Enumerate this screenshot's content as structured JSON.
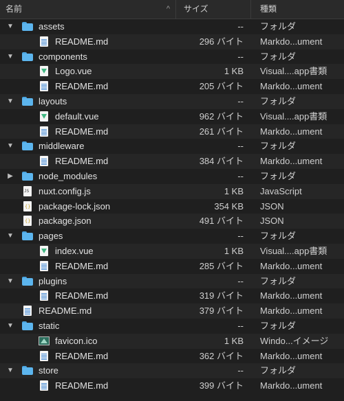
{
  "header": {
    "name_label": "名前",
    "size_label": "サイズ",
    "kind_label": "種類",
    "sort_indicator": "^"
  },
  "rows": [
    {
      "indent": 0,
      "disclosure": "open",
      "icon": "folder-icon",
      "name": "assets",
      "size": "--",
      "kind": "フォルダ"
    },
    {
      "indent": 1,
      "disclosure": "none",
      "icon": "markdown-file-icon",
      "name": "README.md",
      "size": "296 バイト",
      "kind": "Markdo...ument"
    },
    {
      "indent": 0,
      "disclosure": "open",
      "icon": "folder-icon",
      "name": "components",
      "size": "--",
      "kind": "フォルダ"
    },
    {
      "indent": 1,
      "disclosure": "none",
      "icon": "vue-file-icon",
      "name": "Logo.vue",
      "size": "1 KB",
      "kind": "Visual....app書類"
    },
    {
      "indent": 1,
      "disclosure": "none",
      "icon": "markdown-file-icon",
      "name": "README.md",
      "size": "205 バイト",
      "kind": "Markdo...ument"
    },
    {
      "indent": 0,
      "disclosure": "open",
      "icon": "folder-icon",
      "name": "layouts",
      "size": "--",
      "kind": "フォルダ"
    },
    {
      "indent": 1,
      "disclosure": "none",
      "icon": "vue-file-icon",
      "name": "default.vue",
      "size": "962 バイト",
      "kind": "Visual....app書類"
    },
    {
      "indent": 1,
      "disclosure": "none",
      "icon": "markdown-file-icon",
      "name": "README.md",
      "size": "261 バイト",
      "kind": "Markdo...ument"
    },
    {
      "indent": 0,
      "disclosure": "open",
      "icon": "folder-icon",
      "name": "middleware",
      "size": "--",
      "kind": "フォルダ"
    },
    {
      "indent": 1,
      "disclosure": "none",
      "icon": "markdown-file-icon",
      "name": "README.md",
      "size": "384 バイト",
      "kind": "Markdo...ument"
    },
    {
      "indent": 0,
      "disclosure": "closed",
      "icon": "folder-icon",
      "name": "node_modules",
      "size": "--",
      "kind": "フォルダ"
    },
    {
      "indent": 0,
      "disclosure": "none",
      "icon": "js-file-icon",
      "name": "nuxt.config.js",
      "size": "1 KB",
      "kind": "JavaScript"
    },
    {
      "indent": 0,
      "disclosure": "none",
      "icon": "json-file-icon",
      "name": "package-lock.json",
      "size": "354 KB",
      "kind": "JSON"
    },
    {
      "indent": 0,
      "disclosure": "none",
      "icon": "json-file-icon",
      "name": "package.json",
      "size": "491 バイト",
      "kind": "JSON"
    },
    {
      "indent": 0,
      "disclosure": "open",
      "icon": "folder-icon",
      "name": "pages",
      "size": "--",
      "kind": "フォルダ"
    },
    {
      "indent": 1,
      "disclosure": "none",
      "icon": "vue-file-icon",
      "name": "index.vue",
      "size": "1 KB",
      "kind": "Visual....app書類"
    },
    {
      "indent": 1,
      "disclosure": "none",
      "icon": "markdown-file-icon",
      "name": "README.md",
      "size": "285 バイト",
      "kind": "Markdo...ument"
    },
    {
      "indent": 0,
      "disclosure": "open",
      "icon": "folder-icon",
      "name": "plugins",
      "size": "--",
      "kind": "フォルダ"
    },
    {
      "indent": 1,
      "disclosure": "none",
      "icon": "markdown-file-icon",
      "name": "README.md",
      "size": "319 バイト",
      "kind": "Markdo...ument"
    },
    {
      "indent": 0,
      "disclosure": "none",
      "icon": "markdown-file-icon",
      "name": "README.md",
      "size": "379 バイト",
      "kind": "Markdo...ument"
    },
    {
      "indent": 0,
      "disclosure": "open",
      "icon": "folder-icon",
      "name": "static",
      "size": "--",
      "kind": "フォルダ"
    },
    {
      "indent": 1,
      "disclosure": "none",
      "icon": "image-file-icon",
      "name": "favicon.ico",
      "size": "1 KB",
      "kind": "Windo...イメージ"
    },
    {
      "indent": 1,
      "disclosure": "none",
      "icon": "markdown-file-icon",
      "name": "README.md",
      "size": "362 バイト",
      "kind": "Markdo...ument"
    },
    {
      "indent": 0,
      "disclosure": "open",
      "icon": "folder-icon",
      "name": "store",
      "size": "--",
      "kind": "フォルダ"
    },
    {
      "indent": 1,
      "disclosure": "none",
      "icon": "markdown-file-icon",
      "name": "README.md",
      "size": "399 バイト",
      "kind": "Markdo...ument"
    }
  ]
}
